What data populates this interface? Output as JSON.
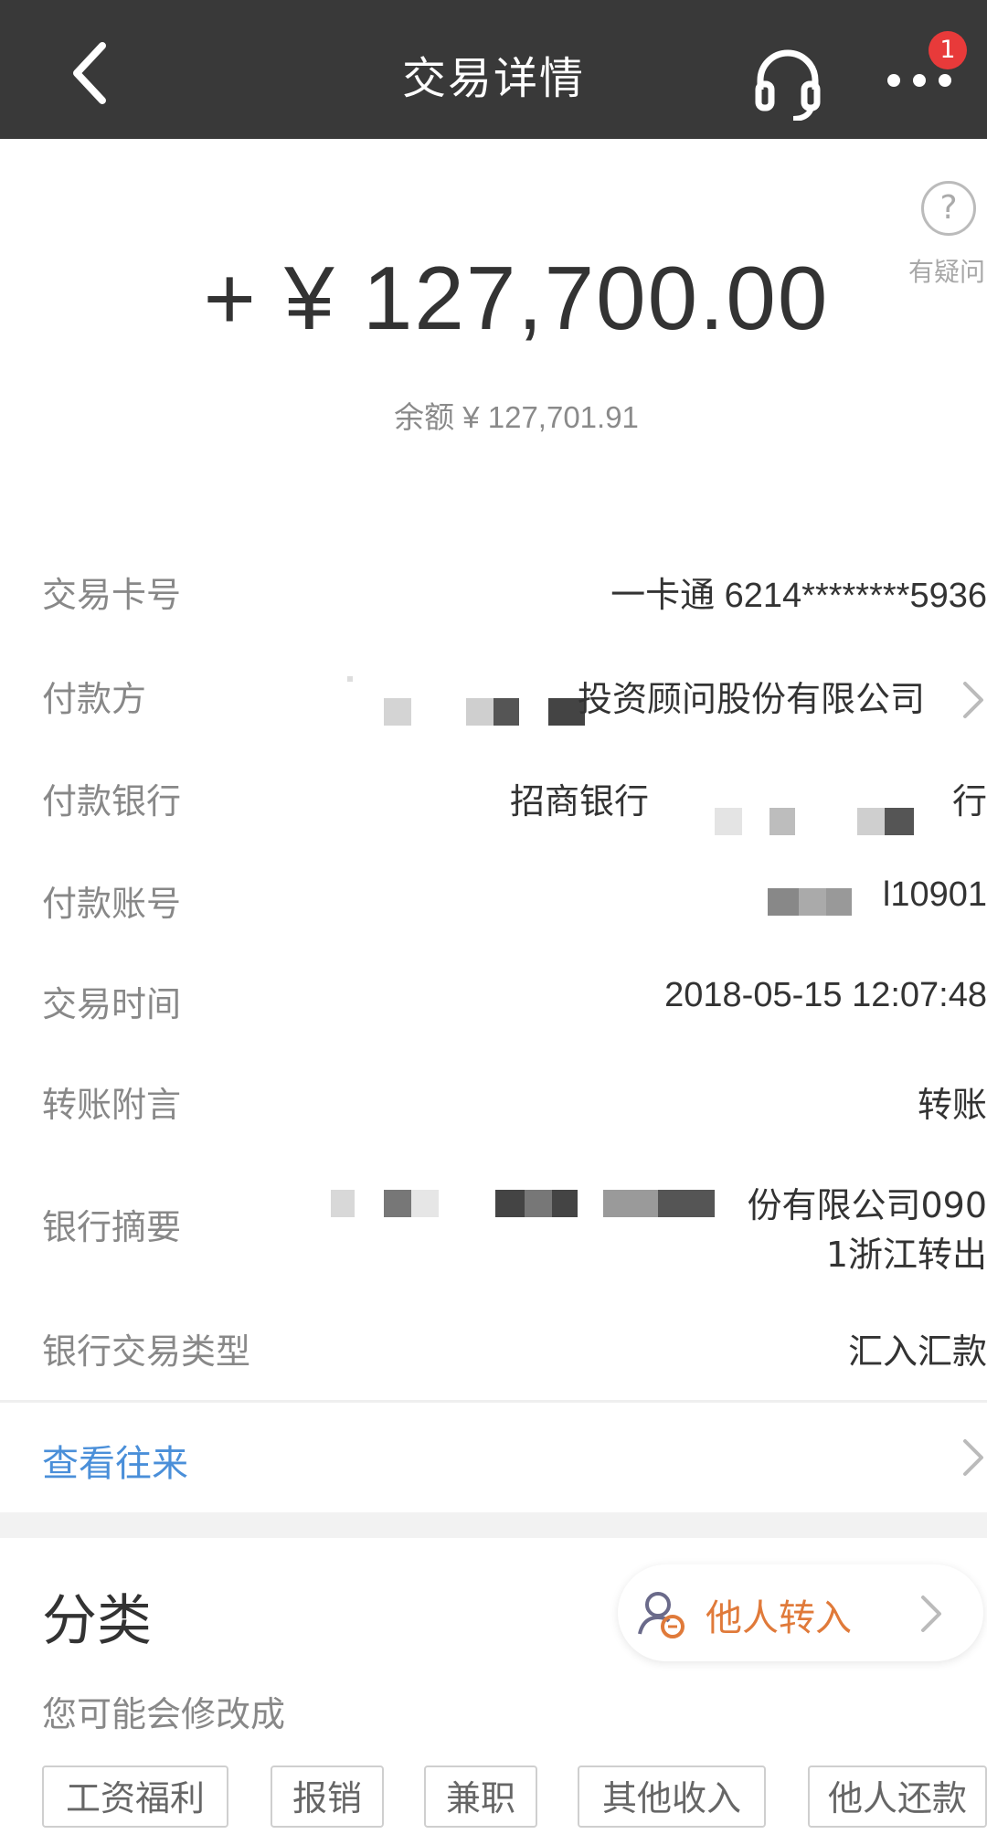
{
  "header": {
    "title": "交易详情",
    "badge_count": "1"
  },
  "help": {
    "icon_glyph": "?",
    "label": "有疑问"
  },
  "amount": "+ ¥ 127,700.00",
  "balance": "余额 ¥ 127,701.91",
  "details": [
    {
      "label": "交易卡号",
      "value": "一卡通 6214********5936"
    },
    {
      "label": "付款方",
      "value": "投资顾问股份有限公司"
    },
    {
      "label": "付款银行",
      "value": "招商银行",
      "value_tail": "行"
    },
    {
      "label": "付款账号",
      "value": "l10901"
    },
    {
      "label": "交易时间",
      "value": "2018-05-15 12:07:48"
    },
    {
      "label": "转账附言",
      "value": "转账"
    },
    {
      "label": "银行摘要",
      "value_line1": "份有限公司090",
      "value_line2": "1浙江转出"
    },
    {
      "label": "银行交易类型",
      "value": "汇入汇款"
    }
  ],
  "view_history": "查看往来",
  "category": {
    "title": "分类",
    "current": "他人转入",
    "suggest_label": "您可能会修改成",
    "options": [
      "工资福利",
      "报销",
      "兼职",
      "其他收入",
      "他人还款"
    ]
  },
  "colors": {
    "header_bg": "#393939",
    "link": "#4a8fd9",
    "accent": "#e07a3a",
    "badge": "#e83a3a"
  }
}
